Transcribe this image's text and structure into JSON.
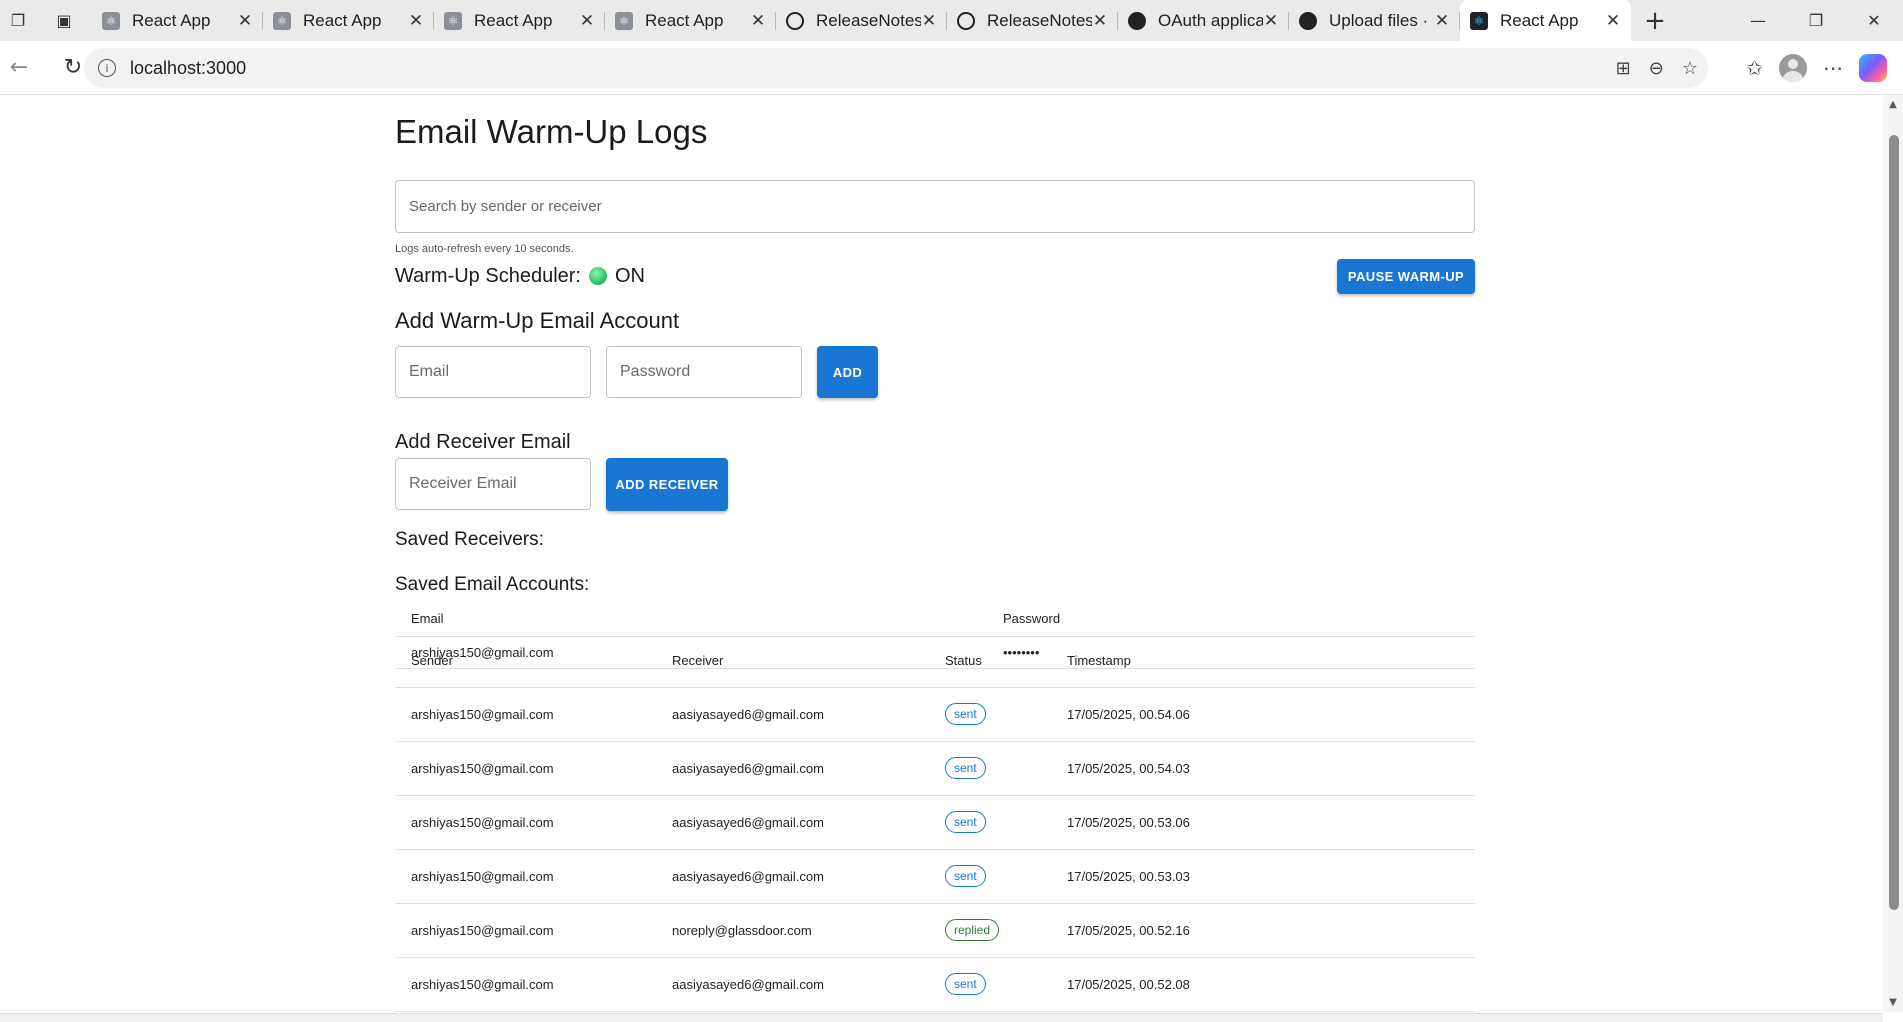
{
  "browser": {
    "tabs": [
      {
        "title": "React App",
        "favicon": "react-icon"
      },
      {
        "title": "React App",
        "favicon": "react-icon"
      },
      {
        "title": "React App",
        "favicon": "react-icon"
      },
      {
        "title": "React App",
        "favicon": "react-icon"
      },
      {
        "title": "ReleaseNotes.",
        "favicon": "globe-icon"
      },
      {
        "title": "ReleaseNotes.",
        "favicon": "globe-icon"
      },
      {
        "title": "OAuth applica",
        "favicon": "github-icon"
      },
      {
        "title": "Upload files ·",
        "favicon": "github-icon"
      },
      {
        "title": "React App",
        "favicon": "react-icon",
        "active": true
      }
    ],
    "url": "localhost:3000"
  },
  "page": {
    "title": "Email Warm-Up Logs",
    "search_placeholder": "Search by sender or receiver",
    "refresh_note": "Logs auto-refresh every 10 seconds.",
    "scheduler_label": "Warm-Up Scheduler:",
    "scheduler_state": "ON",
    "scheduler_color": "#2bc46a",
    "pause_button": "PAUSE WARM-UP",
    "add_account_heading": "Add Warm-Up Email Account",
    "email_placeholder": "Email",
    "password_placeholder": "Password",
    "add_button": "ADD",
    "add_receiver_heading": "Add Receiver Email",
    "receiver_placeholder": "Receiver Email",
    "add_receiver_button": "ADD RECEIVER",
    "saved_receivers_heading": "Saved Receivers:",
    "saved_accounts_heading": "Saved Email Accounts:",
    "accent_color": "#1976d2"
  },
  "accounts_table": {
    "headers": [
      "Email",
      "Password"
    ],
    "rows": [
      [
        "arshiyas150@gmail.com",
        "••••••••"
      ]
    ]
  },
  "logs_table": {
    "headers": [
      "Sender",
      "Receiver",
      "Status",
      "Timestamp"
    ],
    "rows": [
      [
        "arshiyas150@gmail.com",
        "aasiyasayed6@gmail.com",
        "sent",
        "17/05/2025, 00.54.06"
      ],
      [
        "arshiyas150@gmail.com",
        "aasiyasayed6@gmail.com",
        "sent",
        "17/05/2025, 00.54.03"
      ],
      [
        "arshiyas150@gmail.com",
        "aasiyasayed6@gmail.com",
        "sent",
        "17/05/2025, 00.53.06"
      ],
      [
        "arshiyas150@gmail.com",
        "aasiyasayed6@gmail.com",
        "sent",
        "17/05/2025, 00.53.03"
      ],
      [
        "arshiyas150@gmail.com",
        "noreply@glassdoor.com",
        "replied",
        "17/05/2025, 00.52.16"
      ],
      [
        "arshiyas150@gmail.com",
        "aasiyasayed6@gmail.com",
        "sent",
        "17/05/2025, 00.52.08"
      ]
    ]
  }
}
